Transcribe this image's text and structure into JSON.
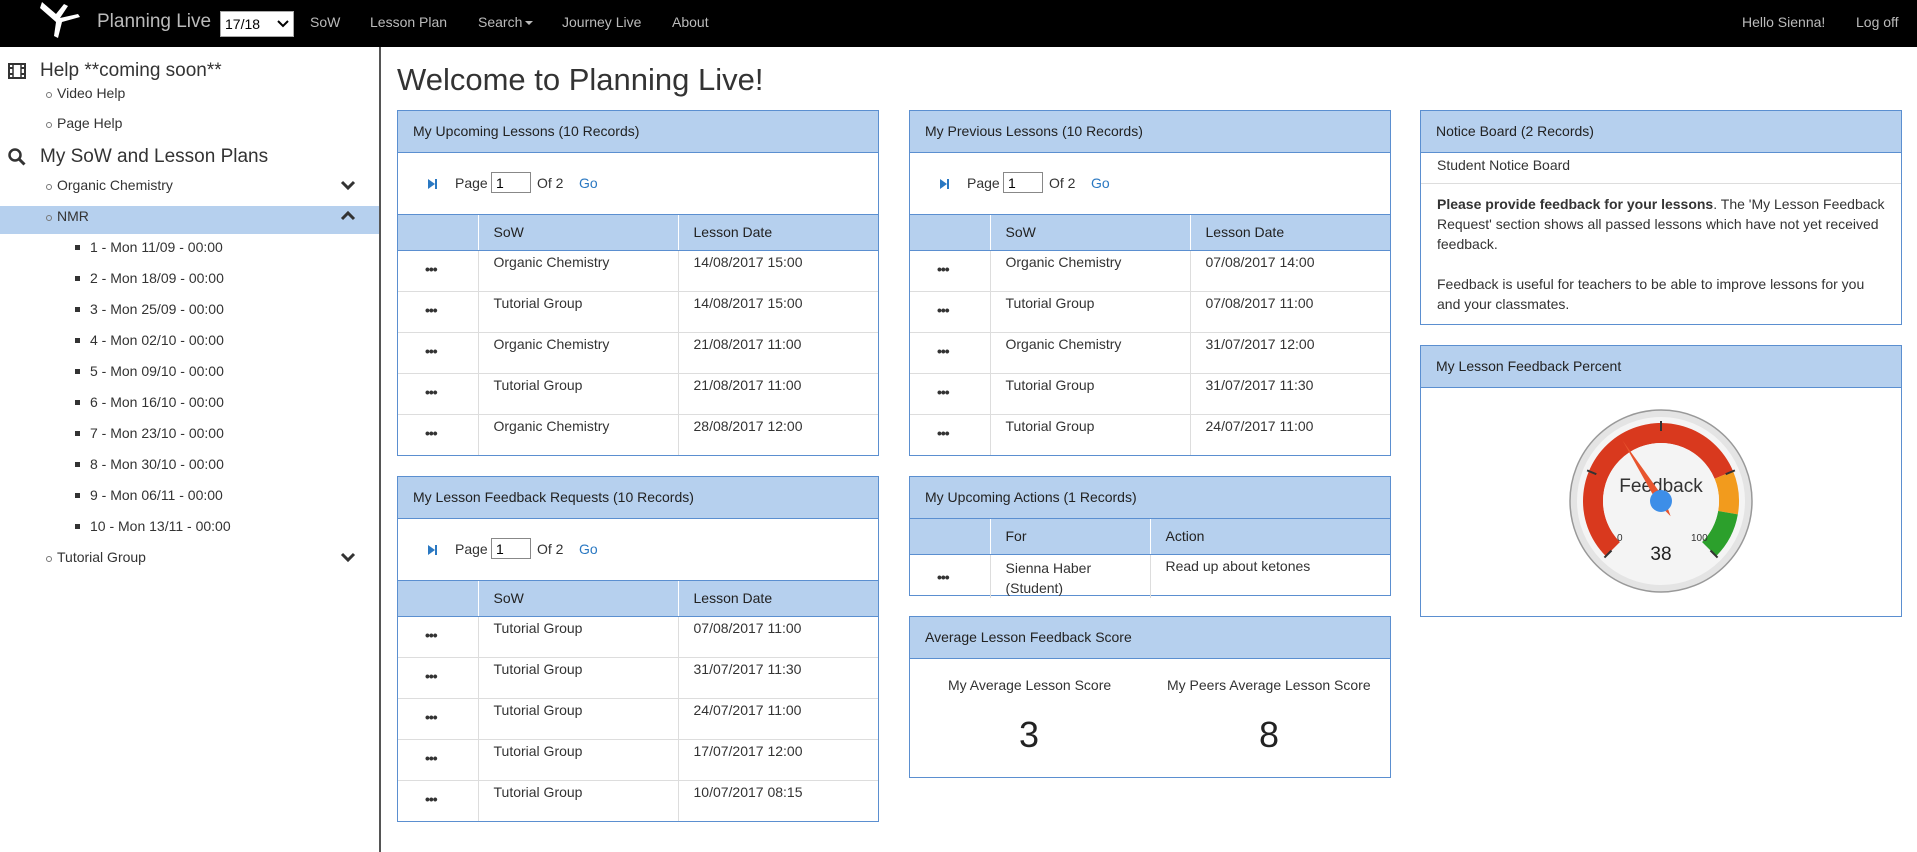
{
  "navbar": {
    "brand": "Planning Live",
    "year_selected": "17/18",
    "links": [
      "SoW",
      "Lesson Plan",
      "Search",
      "Journey Live",
      "About"
    ],
    "greeting": "Hello Sienna!",
    "logoff": "Log off"
  },
  "sidebar": {
    "help_title": "Help **coming soon**",
    "help_items": [
      "Video Help",
      "Page Help"
    ],
    "sow_title": "My SoW and Lesson Plans",
    "sow_items": [
      "Organic Chemistry",
      "NMR",
      "Tutorial Group"
    ],
    "nmr_lessons": [
      "1 - Mon 11/09 - 00:00",
      "2 - Mon 18/09 - 00:00",
      "3 - Mon 25/09 - 00:00",
      "4 - Mon 02/10 - 00:00",
      "5 - Mon 09/10 - 00:00",
      "6 - Mon 16/10 - 00:00",
      "7 - Mon 23/10 - 00:00",
      "8 - Mon 30/10 - 00:00",
      "9 - Mon 06/11 - 00:00",
      "10 - Mon 13/11 - 00:00"
    ]
  },
  "page_title": "Welcome to Planning Live!",
  "pager": {
    "page": "Page",
    "value": "1",
    "of": "Of 2",
    "go": "Go"
  },
  "upcoming": {
    "title": "My Upcoming Lessons (10 Records)",
    "headers": [
      "SoW",
      "Lesson Date"
    ],
    "rows": [
      [
        "Organic Chemistry",
        "14/08/2017 15:00"
      ],
      [
        "Tutorial Group",
        "14/08/2017 15:00"
      ],
      [
        "Organic Chemistry",
        "21/08/2017 11:00"
      ],
      [
        "Tutorial Group",
        "21/08/2017 11:00"
      ],
      [
        "Organic Chemistry",
        "28/08/2017 12:00"
      ]
    ]
  },
  "previous": {
    "title": "My Previous Lessons (10 Records)",
    "headers": [
      "SoW",
      "Lesson Date"
    ],
    "rows": [
      [
        "Organic Chemistry",
        "07/08/2017 14:00"
      ],
      [
        "Tutorial Group",
        "07/08/2017 11:00"
      ],
      [
        "Organic Chemistry",
        "31/07/2017 12:00"
      ],
      [
        "Tutorial Group",
        "31/07/2017 11:30"
      ],
      [
        "Tutorial Group",
        "24/07/2017 11:00"
      ]
    ]
  },
  "feedback_requests": {
    "title": "My Lesson Feedback Requests (10 Records)",
    "headers": [
      "SoW",
      "Lesson Date"
    ],
    "rows": [
      [
        "Tutorial Group",
        "07/08/2017 11:00"
      ],
      [
        "Tutorial Group",
        "31/07/2017 11:30"
      ],
      [
        "Tutorial Group",
        "24/07/2017 11:00"
      ],
      [
        "Tutorial Group",
        "17/07/2017 12:00"
      ],
      [
        "Tutorial Group",
        "10/07/2017 08:15"
      ]
    ]
  },
  "actions": {
    "title": "My Upcoming Actions (1 Records)",
    "headers": [
      "For",
      "Action"
    ],
    "rows": [
      [
        "Sienna Haber (Student)",
        "Read up about ketones"
      ]
    ]
  },
  "avg_score": {
    "title": "Average Lesson Feedback Score",
    "mine_label": "My Average Lesson Score",
    "mine_value": "3",
    "peers_label": "My Peers Average Lesson Score",
    "peers_value": "8"
  },
  "notice": {
    "title": "Notice Board (2 Records)",
    "board_name": "Student Notice Board",
    "bold_text": "Please provide feedback for your lessons",
    "text1": ". The 'My Lesson Feedback Request' section shows all passed lessons which have not yet received feedback.",
    "text2": "Feedback is useful for teachers to be able to improve lessons for you and your classmates."
  },
  "gauge": {
    "title": "My Lesson Feedback Percent",
    "label": "Feedback",
    "value": 38,
    "value_text": "38",
    "min_label": "0",
    "max_label": "100"
  },
  "colors": {
    "accent": "#2a78c2",
    "panel_head": "#b6d0ee",
    "panel_border": "#5b8fd0"
  }
}
